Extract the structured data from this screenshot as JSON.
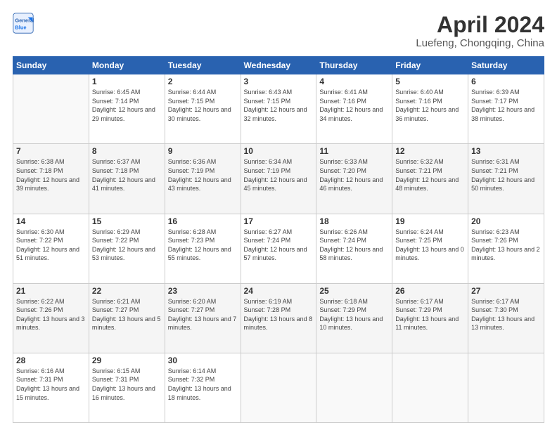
{
  "header": {
    "logo_general": "General",
    "logo_blue": "Blue",
    "month": "April 2024",
    "location": "Luefeng, Chongqing, China"
  },
  "weekdays": [
    "Sunday",
    "Monday",
    "Tuesday",
    "Wednesday",
    "Thursday",
    "Friday",
    "Saturday"
  ],
  "weeks": [
    [
      {
        "day": "",
        "sunrise": "",
        "sunset": "",
        "daylight": ""
      },
      {
        "day": "1",
        "sunrise": "Sunrise: 6:45 AM",
        "sunset": "Sunset: 7:14 PM",
        "daylight": "Daylight: 12 hours and 29 minutes."
      },
      {
        "day": "2",
        "sunrise": "Sunrise: 6:44 AM",
        "sunset": "Sunset: 7:15 PM",
        "daylight": "Daylight: 12 hours and 30 minutes."
      },
      {
        "day": "3",
        "sunrise": "Sunrise: 6:43 AM",
        "sunset": "Sunset: 7:15 PM",
        "daylight": "Daylight: 12 hours and 32 minutes."
      },
      {
        "day": "4",
        "sunrise": "Sunrise: 6:41 AM",
        "sunset": "Sunset: 7:16 PM",
        "daylight": "Daylight: 12 hours and 34 minutes."
      },
      {
        "day": "5",
        "sunrise": "Sunrise: 6:40 AM",
        "sunset": "Sunset: 7:16 PM",
        "daylight": "Daylight: 12 hours and 36 minutes."
      },
      {
        "day": "6",
        "sunrise": "Sunrise: 6:39 AM",
        "sunset": "Sunset: 7:17 PM",
        "daylight": "Daylight: 12 hours and 38 minutes."
      }
    ],
    [
      {
        "day": "7",
        "sunrise": "Sunrise: 6:38 AM",
        "sunset": "Sunset: 7:18 PM",
        "daylight": "Daylight: 12 hours and 39 minutes."
      },
      {
        "day": "8",
        "sunrise": "Sunrise: 6:37 AM",
        "sunset": "Sunset: 7:18 PM",
        "daylight": "Daylight: 12 hours and 41 minutes."
      },
      {
        "day": "9",
        "sunrise": "Sunrise: 6:36 AM",
        "sunset": "Sunset: 7:19 PM",
        "daylight": "Daylight: 12 hours and 43 minutes."
      },
      {
        "day": "10",
        "sunrise": "Sunrise: 6:34 AM",
        "sunset": "Sunset: 7:19 PM",
        "daylight": "Daylight: 12 hours and 45 minutes."
      },
      {
        "day": "11",
        "sunrise": "Sunrise: 6:33 AM",
        "sunset": "Sunset: 7:20 PM",
        "daylight": "Daylight: 12 hours and 46 minutes."
      },
      {
        "day": "12",
        "sunrise": "Sunrise: 6:32 AM",
        "sunset": "Sunset: 7:21 PM",
        "daylight": "Daylight: 12 hours and 48 minutes."
      },
      {
        "day": "13",
        "sunrise": "Sunrise: 6:31 AM",
        "sunset": "Sunset: 7:21 PM",
        "daylight": "Daylight: 12 hours and 50 minutes."
      }
    ],
    [
      {
        "day": "14",
        "sunrise": "Sunrise: 6:30 AM",
        "sunset": "Sunset: 7:22 PM",
        "daylight": "Daylight: 12 hours and 51 minutes."
      },
      {
        "day": "15",
        "sunrise": "Sunrise: 6:29 AM",
        "sunset": "Sunset: 7:22 PM",
        "daylight": "Daylight: 12 hours and 53 minutes."
      },
      {
        "day": "16",
        "sunrise": "Sunrise: 6:28 AM",
        "sunset": "Sunset: 7:23 PM",
        "daylight": "Daylight: 12 hours and 55 minutes."
      },
      {
        "day": "17",
        "sunrise": "Sunrise: 6:27 AM",
        "sunset": "Sunset: 7:24 PM",
        "daylight": "Daylight: 12 hours and 57 minutes."
      },
      {
        "day": "18",
        "sunrise": "Sunrise: 6:26 AM",
        "sunset": "Sunset: 7:24 PM",
        "daylight": "Daylight: 12 hours and 58 minutes."
      },
      {
        "day": "19",
        "sunrise": "Sunrise: 6:24 AM",
        "sunset": "Sunset: 7:25 PM",
        "daylight": "Daylight: 13 hours and 0 minutes."
      },
      {
        "day": "20",
        "sunrise": "Sunrise: 6:23 AM",
        "sunset": "Sunset: 7:26 PM",
        "daylight": "Daylight: 13 hours and 2 minutes."
      }
    ],
    [
      {
        "day": "21",
        "sunrise": "Sunrise: 6:22 AM",
        "sunset": "Sunset: 7:26 PM",
        "daylight": "Daylight: 13 hours and 3 minutes."
      },
      {
        "day": "22",
        "sunrise": "Sunrise: 6:21 AM",
        "sunset": "Sunset: 7:27 PM",
        "daylight": "Daylight: 13 hours and 5 minutes."
      },
      {
        "day": "23",
        "sunrise": "Sunrise: 6:20 AM",
        "sunset": "Sunset: 7:27 PM",
        "daylight": "Daylight: 13 hours and 7 minutes."
      },
      {
        "day": "24",
        "sunrise": "Sunrise: 6:19 AM",
        "sunset": "Sunset: 7:28 PM",
        "daylight": "Daylight: 13 hours and 8 minutes."
      },
      {
        "day": "25",
        "sunrise": "Sunrise: 6:18 AM",
        "sunset": "Sunset: 7:29 PM",
        "daylight": "Daylight: 13 hours and 10 minutes."
      },
      {
        "day": "26",
        "sunrise": "Sunrise: 6:17 AM",
        "sunset": "Sunset: 7:29 PM",
        "daylight": "Daylight: 13 hours and 11 minutes."
      },
      {
        "day": "27",
        "sunrise": "Sunrise: 6:17 AM",
        "sunset": "Sunset: 7:30 PM",
        "daylight": "Daylight: 13 hours and 13 minutes."
      }
    ],
    [
      {
        "day": "28",
        "sunrise": "Sunrise: 6:16 AM",
        "sunset": "Sunset: 7:31 PM",
        "daylight": "Daylight: 13 hours and 15 minutes."
      },
      {
        "day": "29",
        "sunrise": "Sunrise: 6:15 AM",
        "sunset": "Sunset: 7:31 PM",
        "daylight": "Daylight: 13 hours and 16 minutes."
      },
      {
        "day": "30",
        "sunrise": "Sunrise: 6:14 AM",
        "sunset": "Sunset: 7:32 PM",
        "daylight": "Daylight: 13 hours and 18 minutes."
      },
      {
        "day": "",
        "sunrise": "",
        "sunset": "",
        "daylight": ""
      },
      {
        "day": "",
        "sunrise": "",
        "sunset": "",
        "daylight": ""
      },
      {
        "day": "",
        "sunrise": "",
        "sunset": "",
        "daylight": ""
      },
      {
        "day": "",
        "sunrise": "",
        "sunset": "",
        "daylight": ""
      }
    ]
  ]
}
